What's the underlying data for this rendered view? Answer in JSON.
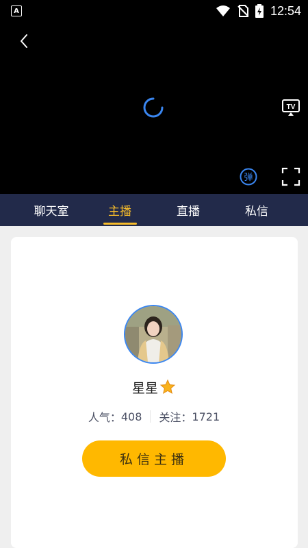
{
  "status_bar": {
    "time": "12:54",
    "left_icon": "A"
  },
  "player": {
    "icons": {
      "back": "chevron-left-icon",
      "loading": "loading-spinner-icon",
      "tv": "tv-cast-icon",
      "danmu": "danmu-toggle-icon",
      "fullscreen": "fullscreen-icon"
    },
    "danmu_label": "弹",
    "tv_label": "TV"
  },
  "tabs": [
    {
      "label": "聊天室",
      "active": false
    },
    {
      "label": "主播",
      "active": true
    },
    {
      "label": "直播",
      "active": false
    },
    {
      "label": "私信",
      "active": false
    }
  ],
  "profile": {
    "name": "星星",
    "star_icon": "star-icon",
    "popularity_label": "人气：",
    "popularity_value": "408",
    "followers_label": "关注：",
    "followers_value": "1721",
    "message_button_label": "私信主播"
  },
  "colors": {
    "tab_bar_bg": "#222a4a",
    "accent": "#f7bc2a",
    "button": "#ffb800",
    "avatar_border": "#3a86f0",
    "spinner": "#3a86f0"
  }
}
